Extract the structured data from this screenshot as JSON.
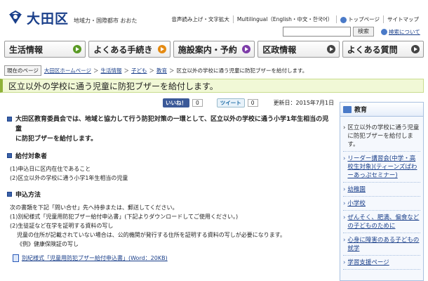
{
  "header": {
    "logo_text": "大田区",
    "logo_sub": "地域力・国際都市 おおた",
    "utility_links": [
      "音声読み上げ・文字拡大",
      "Multilingual（English・中文・한국어）",
      "トップページ",
      "サイトマップ"
    ],
    "search_button": "検索",
    "search_guide": "検索について"
  },
  "global_nav": [
    {
      "label": "生活情報",
      "color": "#5a9a25"
    },
    {
      "label": "よくある手続き",
      "color": "#e48a12"
    },
    {
      "label": "施設案内・予約",
      "color": "#7d3ca8"
    },
    {
      "label": "区政情報",
      "color": "#444444"
    },
    {
      "label": "よくある質問",
      "color": "#444444"
    }
  ],
  "breadcrumb": {
    "label": "現在のページ",
    "items": [
      "大田区ホームページ",
      "生活情報",
      "子ども",
      "教育"
    ],
    "current": "区立以外の学校に通う児童に防犯ブザーを給付します。"
  },
  "page_title": "区立以外の学校に通う児童に防犯ブザーを給付します。",
  "social": {
    "like": "いいね！",
    "like_count": "0",
    "tweet": "ツイート",
    "tweet_count": "0"
  },
  "updated": "更新日：2015年7月1日",
  "intro": [
    "大田区教育委員会では、地域と協力して行う防犯対策の一環として、区立以外の学校に通う小学1年生相当の児童",
    "に防犯ブザーを給付します。"
  ],
  "sections": [
    {
      "heading": "給付対象者",
      "lines": [
        "(1)申込日に区内在住であること",
        "(2)区立以外の学校に通う小学1年生相当の児童"
      ]
    },
    {
      "heading": "申込方法",
      "lines": [
        "次の書類を下記「問い合せ」先へ持参または、郵送してください。",
        "(1)別紀様式「児童用防犯ブザー給付申込書」(下記よりダウンロードしてご使用ください。)",
        "(2)生徒証など在学を証明する資料の写し"
      ],
      "indent_lines": [
        "児童の住所が記載されていない場合は、公的機関が発行する住所を証明する資料の写しが必要になります。",
        "《例》健康保険証の写し"
      ]
    }
  ],
  "file_link": "別紀様式「児童用防犯ブザー給付申込書」(Word：20KB)",
  "sidebar": {
    "heading": "教育",
    "items": [
      {
        "label": "区立以外の学校に通う児童に防犯ブザーを給付します。",
        "current": true
      },
      {
        "label": "リーダー講習会(中学・高校生対象)(ティーンズぱわーあっぷセミナー)",
        "current": false
      },
      {
        "label": "幼稚園",
        "current": false
      },
      {
        "label": "小学校",
        "current": false
      },
      {
        "label": "ぜんそく、肥満、偏食などの子どものために",
        "current": false
      },
      {
        "label": "心身に障害のある子どもの就学",
        "current": false
      },
      {
        "label": "学習支援ページ",
        "current": false
      }
    ]
  }
}
